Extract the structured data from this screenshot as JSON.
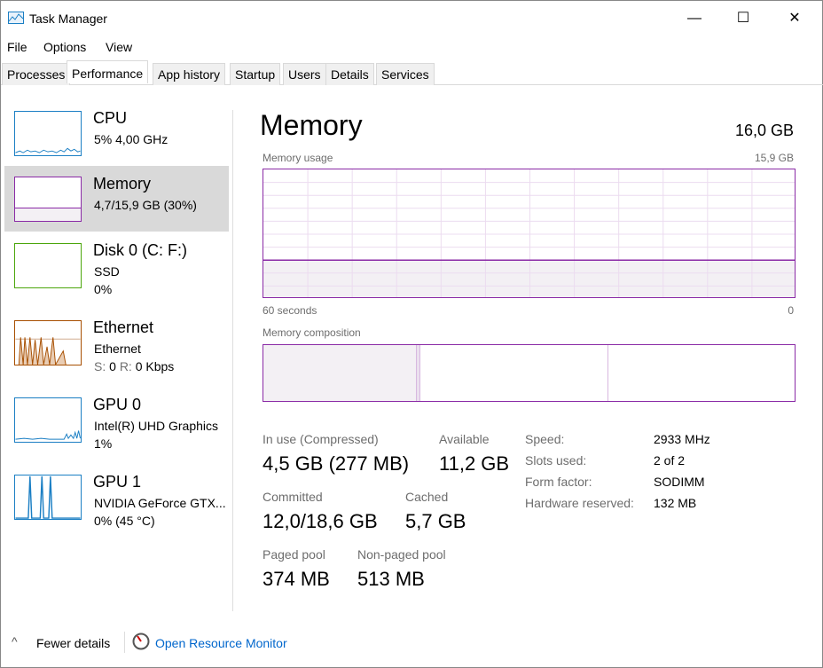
{
  "window": {
    "title": "Task Manager",
    "minimize": "—",
    "maximize": "☐",
    "close": "✕"
  },
  "menu": [
    "File",
    "Options",
    "View"
  ],
  "tabs": [
    "Processes",
    "Performance",
    "App history",
    "Startup",
    "Users",
    "Details",
    "Services"
  ],
  "active_tab": "Performance",
  "sidebar": [
    {
      "name": "CPU",
      "line1": "5% 4,00 GHz",
      "line2": "",
      "color": "#1b7fc4"
    },
    {
      "name": "Memory",
      "line1": "4,7/15,9 GB (30%)",
      "line2": "",
      "color": "#8a2aa6"
    },
    {
      "name": "Disk 0 (C: F:)",
      "line1": "SSD",
      "line2": "0%",
      "color": "#4ca60c"
    },
    {
      "name": "Ethernet",
      "line1": "Ethernet",
      "line2_s": "S:",
      "line2_sv": "0",
      "line2_r": "R:",
      "line2_rv": "0 Kbps",
      "color": "#a74f01"
    },
    {
      "name": "GPU 0",
      "line1": "Intel(R) UHD Graphics",
      "line2": "1%",
      "color": "#1b7fc4"
    },
    {
      "name": "GPU 1",
      "line1": "NVIDIA GeForce GTX...",
      "line2": "0% (45 °C)",
      "color": "#1b7fc4"
    }
  ],
  "main": {
    "title": "Memory",
    "total": "16,0 GB",
    "usage_label": "Memory usage",
    "usage_max": "15,9 GB",
    "usage_percent": 30,
    "x_left": "60 seconds",
    "x_right": "0",
    "composition_label": "Memory composition",
    "stats": {
      "in_use_label": "In use (Compressed)",
      "in_use": "4,5 GB (277 MB)",
      "available_label": "Available",
      "available": "11,2 GB",
      "committed_label": "Committed",
      "committed": "12,0/18,6 GB",
      "cached_label": "Cached",
      "cached": "5,7 GB",
      "paged_label": "Paged pool",
      "paged": "374 MB",
      "nonpaged_label": "Non-paged pool",
      "nonpaged": "513 MB"
    },
    "specs": [
      {
        "k": "Speed:",
        "v": "2933 MHz"
      },
      {
        "k": "Slots used:",
        "v": "2 of 2"
      },
      {
        "k": "Form factor:",
        "v": "SODIMM"
      },
      {
        "k": "Hardware reserved:",
        "v": "132 MB"
      }
    ]
  },
  "footer": {
    "fewer": "Fewer details",
    "monitor": "Open Resource Monitor"
  }
}
